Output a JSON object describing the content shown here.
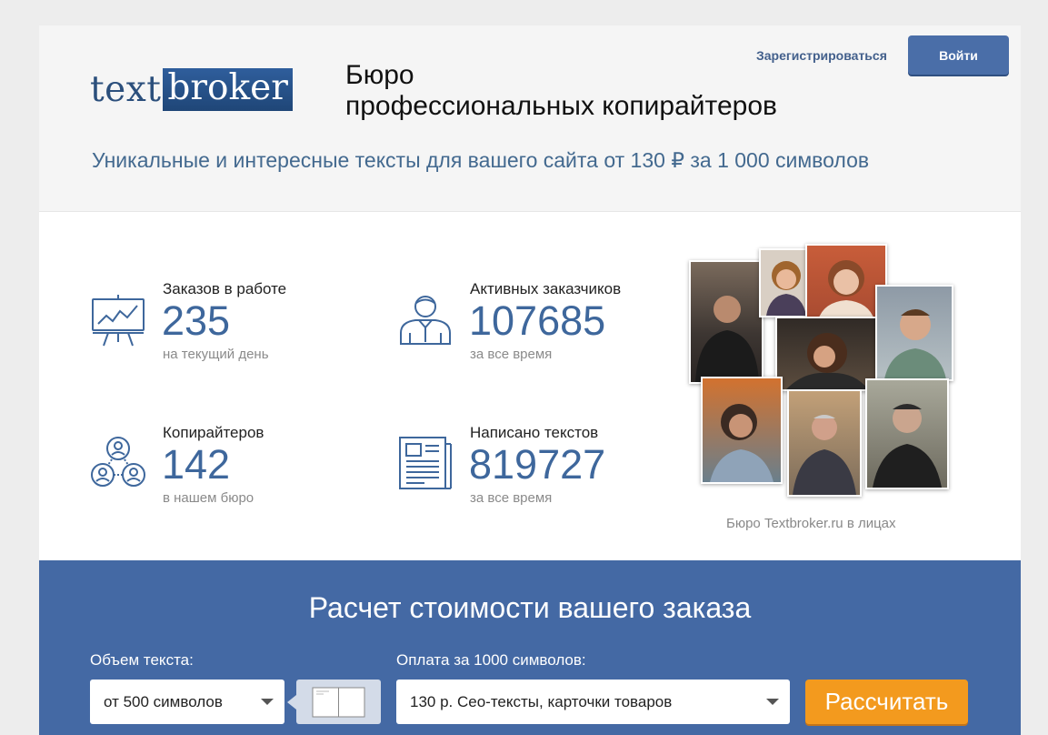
{
  "header": {
    "logo": {
      "part1": "text",
      "part2": "broker"
    },
    "tagline_line1": "Бюро",
    "tagline_line2": "профессиональных копирайтеров",
    "register_label": "Зарегистрироваться",
    "login_label": "Войти",
    "subheading": "Уникальные и интересные тексты для вашего сайта от 130 ₽ за 1 000 символов"
  },
  "stats": [
    {
      "label": "Заказов в работе",
      "value": "235",
      "note": "на текущий день",
      "icon": "presentation-chart-icon"
    },
    {
      "label": "Активных заказчиков",
      "value": "107685",
      "note": "за все время",
      "icon": "person-icon"
    },
    {
      "label": "Копирайтеров",
      "value": "142",
      "note": "в нашем бюро",
      "icon": "team-icon"
    },
    {
      "label": "Написано текстов",
      "value": "819727",
      "note": "за все время",
      "icon": "newspaper-icon"
    }
  ],
  "collage": {
    "caption": "Бюро Textbroker.ru в лицах"
  },
  "calculator": {
    "title": "Расчет стоимости вашего заказа",
    "volume_label": "Объем текста:",
    "volume_value": "от 500 символов",
    "payment_label": "Оплата за 1000 символов:",
    "payment_value": "130 р. Сео-тексты, карточки товаров",
    "submit_label": "Рассчитать"
  },
  "colors": {
    "accent": "#4469a4",
    "number": "#3e679c",
    "button_orange": "#f39a1e",
    "login_button": "#4a6ea8"
  }
}
